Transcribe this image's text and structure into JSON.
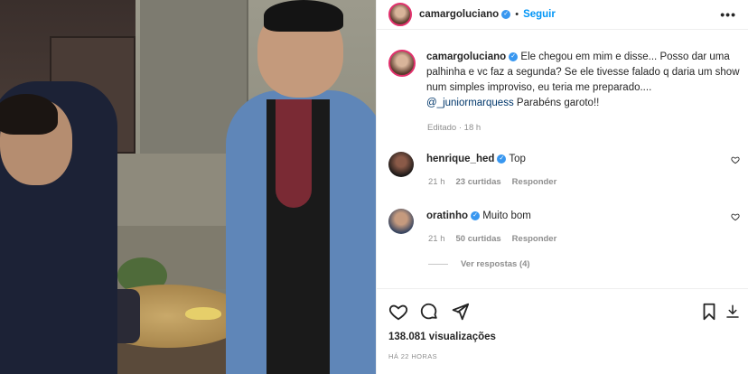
{
  "header": {
    "username": "camargoluciano",
    "separator": "•",
    "follow_label": "Seguir",
    "more_label": "•••"
  },
  "caption": {
    "username": "camargoluciano",
    "text": "Ele chegou em mim e disse... Posso dar uma palhinha e vc faz a segunda? Se ele tivesse falado q daria um show num simples improviso, eu teria me preparado....",
    "mention": "@_juniormarquess",
    "text_after": "Parabéns garoto!!",
    "edited": "Editado · 18 h"
  },
  "comments": [
    {
      "username": "henrique_hed",
      "text": "Top",
      "time": "21 h",
      "likes": "23 curtidas",
      "reply": "Responder"
    },
    {
      "username": "oratinho",
      "text": "Muito bom",
      "time": "21 h",
      "likes": "50 curtidas",
      "reply": "Responder"
    }
  ],
  "view_replies": "Ver respostas (4)",
  "footer": {
    "views": "138.081 visualizações",
    "posted": "HÁ 22 HORAS"
  },
  "icons": {
    "like": "heart-icon",
    "comment": "comment-icon",
    "share": "share-icon",
    "save": "bookmark-icon",
    "more": "more-icon",
    "verified": "verified-badge-icon"
  },
  "colors": {
    "accent": "#0095f6",
    "verified": "#3897f0",
    "muted": "#8e8e8e"
  }
}
